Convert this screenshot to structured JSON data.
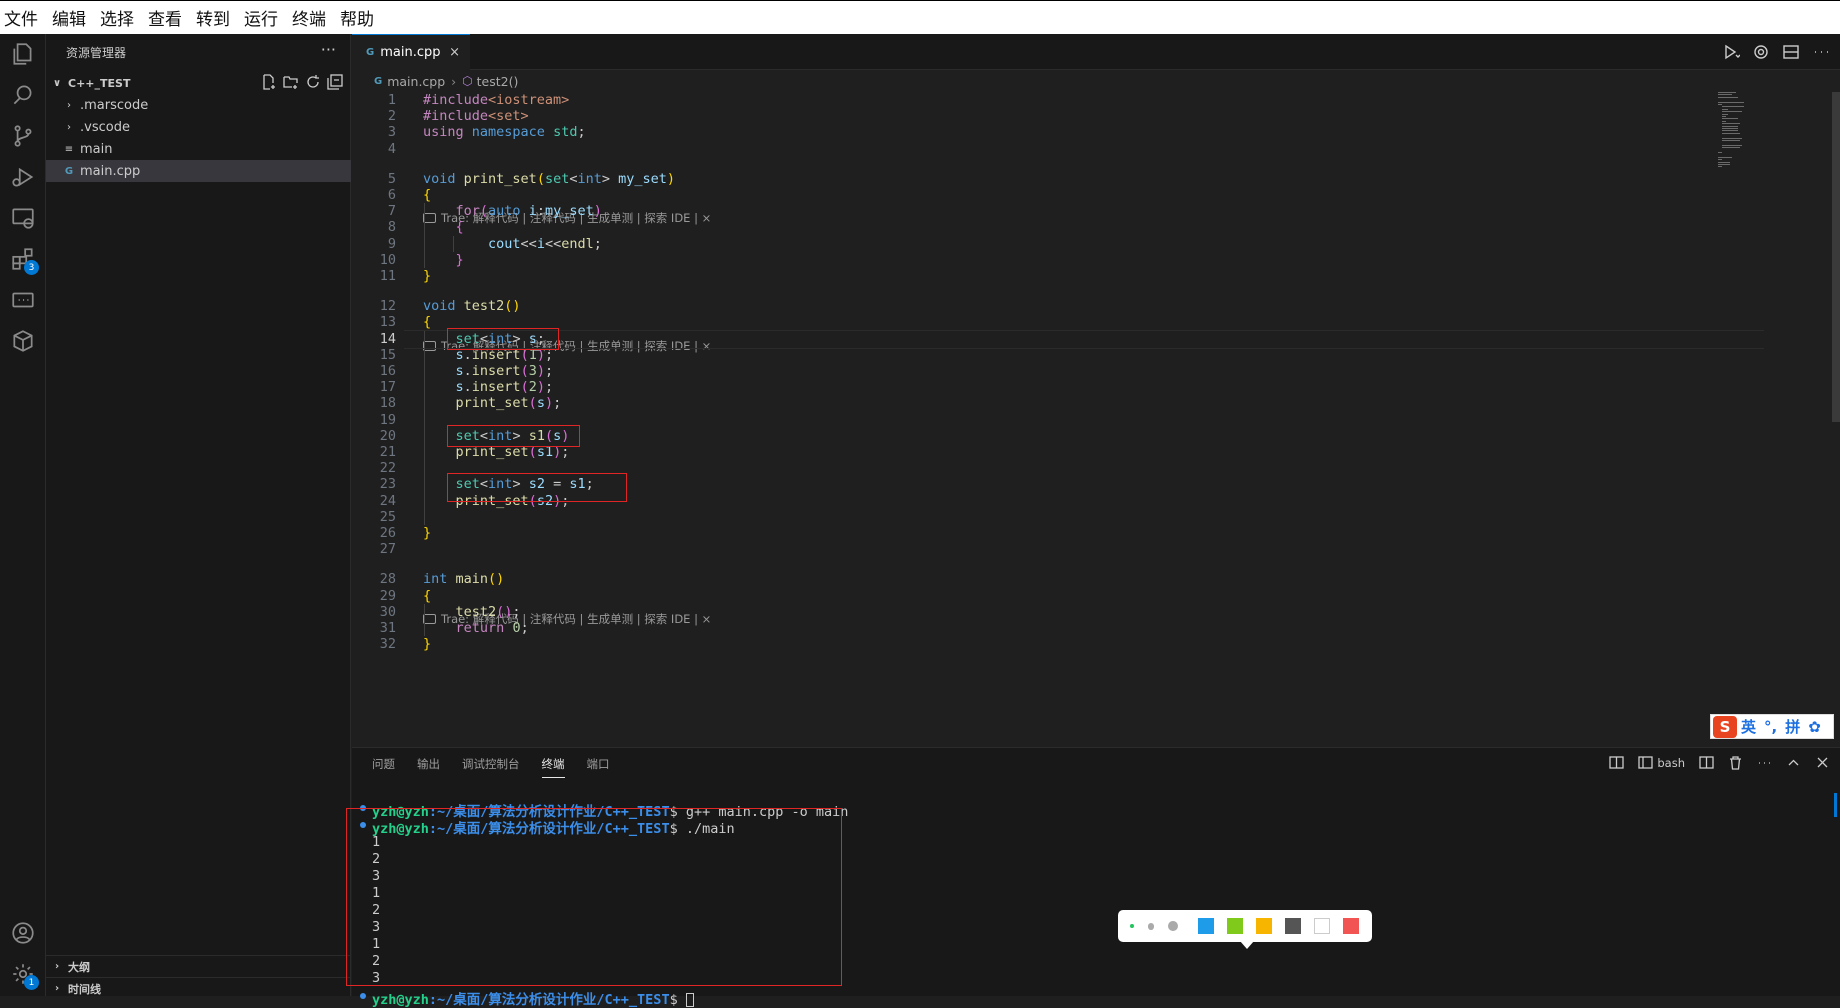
{
  "menu": [
    "文件",
    "编辑",
    "选择",
    "查看",
    "转到",
    "运行",
    "终端",
    "帮助"
  ],
  "explorer": {
    "title": "资源管理器",
    "more": "···",
    "project": "C++_TEST",
    "items": [
      {
        "label": ".marscode",
        "icon": "chevron-right-icon",
        "glyph": "›"
      },
      {
        "label": ".vscode",
        "icon": "chevron-right-icon",
        "glyph": "›"
      },
      {
        "label": "main",
        "icon": "file-lines-icon",
        "glyph": "≡"
      },
      {
        "label": "main.cpp",
        "icon": "cpp-file-icon",
        "glyph": "G"
      }
    ],
    "outline": "大纲",
    "timeline": "时间线"
  },
  "activity_badges": {
    "extensions": "3",
    "settings": "1"
  },
  "editor": {
    "tab": {
      "label": "main.cpp",
      "close": "×",
      "glyph": "G"
    },
    "breadcrumb": {
      "file": "main.cpp",
      "symbol": "test2()"
    },
    "codelens": "Trae: 解释代码 | 注释代码 | 生成单测 | 探索 IDE | ×",
    "lines": [
      {
        "n": "1",
        "html": "<span class=\"kw2\">#include</span><span class=\"inc\">&lt;iostream&gt;</span>"
      },
      {
        "n": "2",
        "html": "<span class=\"kw2\">#include</span><span class=\"inc\">&lt;set&gt;</span>"
      },
      {
        "n": "3",
        "html": "<span class=\"kw2\">using</span> <span class=\"kw\">namespace</span> <span class=\"ty\">std</span>;"
      },
      {
        "n": "4",
        "html": ""
      },
      {
        "n": "5",
        "html": "<span class=\"kw\">void</span> <span class=\"fn\">print_set</span><span class=\"br\">(</span><span class=\"ty\">set</span>&lt;<span class=\"kw\">int</span>&gt; <span class=\"va\">my_set</span><span class=\"br\">)</span>"
      },
      {
        "n": "6",
        "html": "<span class=\"br\">{</span>"
      },
      {
        "n": "7",
        "html": "    <span class=\"kw2\">for</span><span class=\"br2\">(</span><span class=\"kw\">auto</span> <span class=\"va\">i</span>:<span class=\"va\">my_set</span><span class=\"br2\">)</span>"
      },
      {
        "n": "8",
        "html": "    <span class=\"br2\">{</span>"
      },
      {
        "n": "9",
        "html": "        <span class=\"va\">cout</span>&lt;&lt;<span class=\"va\">i</span>&lt;&lt;<span class=\"fn\">endl</span>;"
      },
      {
        "n": "10",
        "html": "    <span class=\"br2\">}</span>"
      },
      {
        "n": "11",
        "html": "<span class=\"br\">}</span>"
      },
      {
        "n": "12",
        "html": "<span class=\"kw\">void</span> <span class=\"fn\">test2</span><span class=\"br\">()</span>"
      },
      {
        "n": "13",
        "html": "<span class=\"br\">{</span>"
      },
      {
        "n": "14",
        "html": "    <span class=\"ty\">set</span>&lt;<span class=\"kw\">int</span>&gt; <span class=\"va\">s</span>;"
      },
      {
        "n": "15",
        "html": "    <span class=\"va\">s</span>.<span class=\"fn\">insert</span><span class=\"br2\">(</span><span class=\"num\">1</span><span class=\"br2\">)</span>;"
      },
      {
        "n": "16",
        "html": "    <span class=\"va\">s</span>.<span class=\"fn\">insert</span><span class=\"br2\">(</span><span class=\"num\">3</span><span class=\"br2\">)</span>;"
      },
      {
        "n": "17",
        "html": "    <span class=\"va\">s</span>.<span class=\"fn\">insert</span><span class=\"br2\">(</span><span class=\"num\">2</span><span class=\"br2\">)</span>;"
      },
      {
        "n": "18",
        "html": "    <span class=\"fn\">print_set</span><span class=\"br2\">(</span><span class=\"va\">s</span><span class=\"br2\">)</span>;"
      },
      {
        "n": "19",
        "html": ""
      },
      {
        "n": "20",
        "html": "    <span class=\"ty\">set</span>&lt;<span class=\"kw\">int</span>&gt; <span class=\"fn\">s1</span><span class=\"br2\">(</span><span class=\"va\">s</span><span class=\"br2\">)</span>"
      },
      {
        "n": "21",
        "html": "    <span class=\"fn\">print_set</span><span class=\"br2\">(</span><span class=\"va\">s1</span><span class=\"br2\">)</span>;"
      },
      {
        "n": "22",
        "html": ""
      },
      {
        "n": "23",
        "html": "    <span class=\"ty\">set</span>&lt;<span class=\"kw\">int</span>&gt; <span class=\"va\">s2</span> = <span class=\"va\">s1</span>;"
      },
      {
        "n": "24",
        "html": "    <span class=\"fn\">print_set</span><span class=\"br2\">(</span><span class=\"va\">s2</span><span class=\"br2\">)</span>;"
      },
      {
        "n": "25",
        "html": ""
      },
      {
        "n": "26",
        "html": "<span class=\"br\">}</span>"
      },
      {
        "n": "27",
        "html": ""
      },
      {
        "n": "28",
        "html": "<span class=\"kw\">int</span> <span class=\"fn\">main</span><span class=\"br\">()</span>"
      },
      {
        "n": "29",
        "html": "<span class=\"br\">{</span>"
      },
      {
        "n": "30",
        "html": "    <span class=\"fn\">test2</span><span class=\"br2\">()</span>;"
      },
      {
        "n": "31",
        "html": "    <span class=\"kw2\">return</span> <span class=\"num\">0</span>;"
      },
      {
        "n": "32",
        "html": "<span class=\"br\">}</span>"
      }
    ],
    "current_line": "14"
  },
  "panel": {
    "tabs": [
      "问题",
      "输出",
      "调试控制台",
      "终端",
      "端口"
    ],
    "active_tab": "终端",
    "shell": "bash",
    "terminal": {
      "user": "yzh@yzh",
      "path": ":~/桌面/算法分析设计作业/C++_TEST",
      "cmd1": "$ g++ main.cpp -o main",
      "cmd2": "$ ./main",
      "end": "$ ",
      "output": [
        "1",
        "2",
        "3",
        "1",
        "2",
        "3",
        "1",
        "2",
        "3"
      ]
    }
  },
  "ime": {
    "mode": "英",
    "punct": "°,",
    "pinyin": "拼",
    "settings": "✿"
  },
  "palette_colors": [
    "#1e9be9",
    "#7fca1a",
    "#f7b500",
    "#555555",
    "#ffffff",
    "#f25454"
  ],
  "colors": {
    "accent": "#0078d4",
    "highlight": "#e02525"
  }
}
